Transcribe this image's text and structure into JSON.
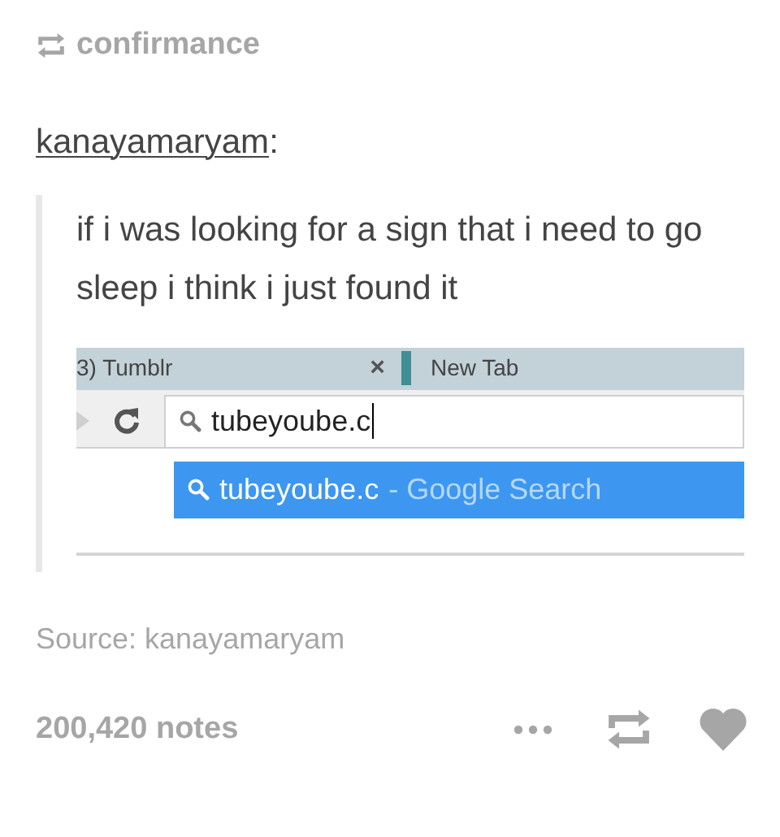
{
  "reblog": {
    "blog": "confirmance"
  },
  "author": {
    "name": "kanayamaryam",
    "suffix": ":"
  },
  "quote": {
    "text": "if i was looking for a sign that i need to go sleep i think i just found it",
    "browser": {
      "tabs": [
        {
          "label": "3) Tumblr",
          "close": "×"
        },
        {
          "label": "New Tab"
        }
      ],
      "omnibox": {
        "value": "tubeyoube.c"
      },
      "suggestions": [
        {
          "query": "tubeyoube.c",
          "suffix": "- Google Search",
          "selected": true
        }
      ]
    }
  },
  "source": "Source: kanayamaryam",
  "notes": "200,420 notes"
}
